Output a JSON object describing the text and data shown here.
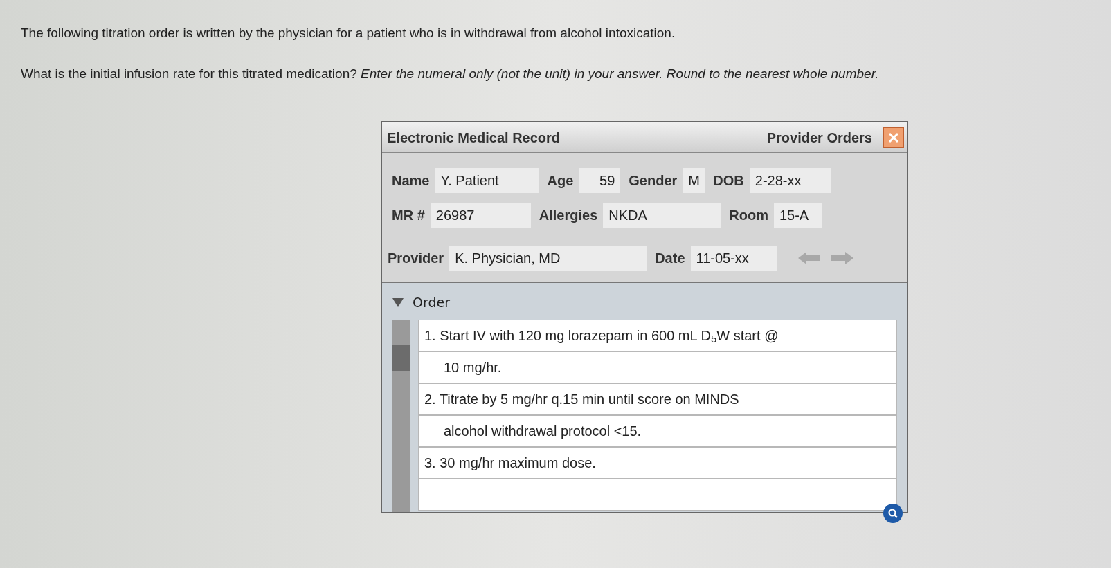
{
  "question": {
    "intro": "The following titration order is written by the physician for a patient who is in withdrawal from alcohol intoxication.",
    "prompt": "What is the initial infusion rate for this titrated medication? *Enter the numeral only (not the unit) in your answer. Round to the nearest whole number.*"
  },
  "emr": {
    "title": "Electronic Medical Record",
    "section": "Provider Orders",
    "fields_row1": [
      {
        "label": "Name",
        "value": "Y. Patient"
      },
      {
        "label": "Age",
        "value": "59"
      },
      {
        "label": "Gender",
        "value": "M"
      },
      {
        "label": "DOB",
        "value": "2-28-xx"
      }
    ],
    "fields_row2": [
      {
        "label": "MR #",
        "value": "26987"
      },
      {
        "label": "Allergies",
        "value": "NKDA"
      },
      {
        "label": "Room",
        "value": "15-A"
      }
    ],
    "provider": {
      "label": "Provider",
      "value": "K. Physician, MD"
    },
    "date": {
      "label": "Date",
      "value": "11-05-xx"
    },
    "order": {
      "heading": "Order",
      "expanded": true,
      "rows": [
        {
          "kind": "first",
          "text": "1. Start IV with 120 mg lorazepam in 600 mL D$_{5}$W start @"
        },
        {
          "kind": "continuation",
          "text": "10 mg/hr."
        },
        {
          "kind": "first",
          "text": "2. Titrate by 5 mg/hr q.15 min until score on MINDS"
        },
        {
          "kind": "continuation",
          "text": "alcohol withdrawal protocol <15."
        },
        {
          "kind": "first",
          "text": "3. 30 mg/hr maximum dose."
        }
      ]
    }
  }
}
